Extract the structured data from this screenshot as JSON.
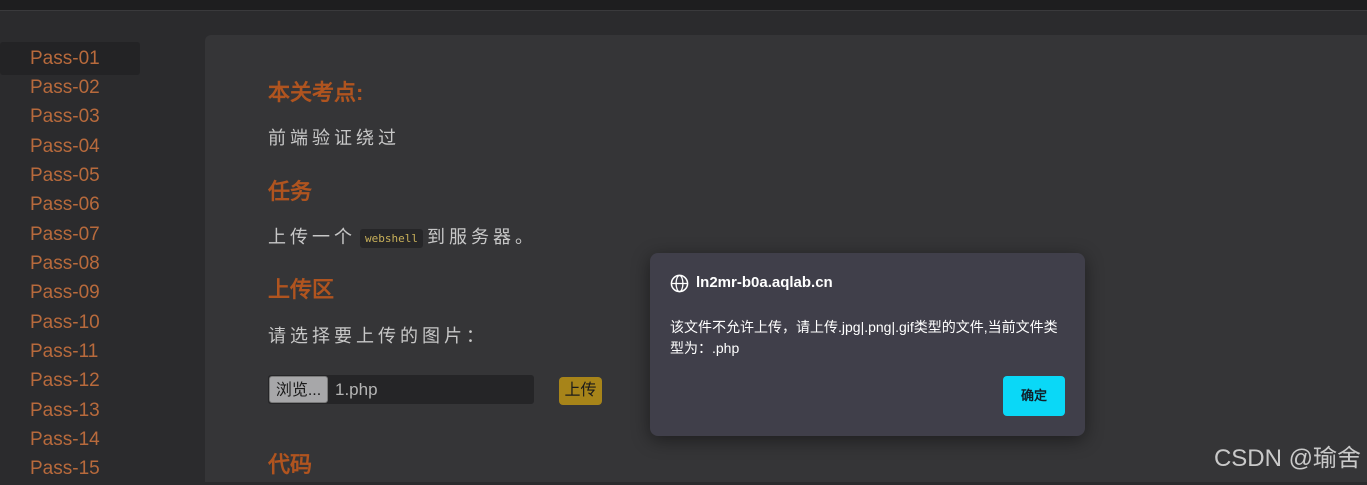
{
  "sidebar": {
    "items": [
      {
        "label": "Pass-01"
      },
      {
        "label": "Pass-02"
      },
      {
        "label": "Pass-03"
      },
      {
        "label": "Pass-04"
      },
      {
        "label": "Pass-05"
      },
      {
        "label": "Pass-06"
      },
      {
        "label": "Pass-07"
      },
      {
        "label": "Pass-08"
      },
      {
        "label": "Pass-09"
      },
      {
        "label": "Pass-10"
      },
      {
        "label": "Pass-11"
      },
      {
        "label": "Pass-12"
      },
      {
        "label": "Pass-13"
      },
      {
        "label": "Pass-14"
      },
      {
        "label": "Pass-15"
      }
    ],
    "active": "Pass-01"
  },
  "main": {
    "section_point_heading": "本关考点:",
    "section_point_text": "前端验证绕过",
    "task_heading": "任务",
    "task_prefix": "上传一个",
    "task_code": "webshell",
    "task_suffix": "到服务器。",
    "upload_heading": "上传区",
    "upload_prompt": "请选择要上传的图片：",
    "browse_label": "浏览...",
    "file_name": "1.php",
    "upload_button": "上传",
    "code_heading": "代码"
  },
  "dialog": {
    "title": "ln2mr-b0a.aqlab.cn",
    "message": "该文件不允许上传，请上传.jpg|.png|.gif类型的文件,当前文件类型为：.php",
    "ok_label": "确定"
  },
  "watermark": "CSDN @瑜舍",
  "colors": {
    "heading": "#b0541f",
    "sidebar_link": "#b86a3c",
    "dialog_button": "#0ad8f7",
    "upload_button": "#a78419"
  }
}
